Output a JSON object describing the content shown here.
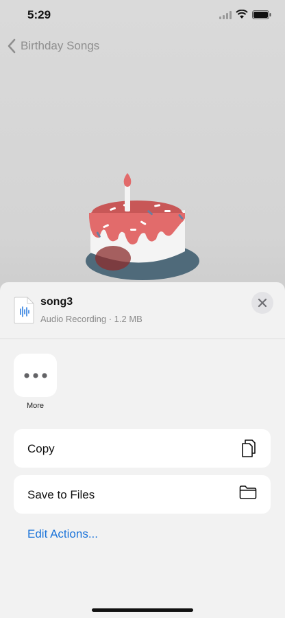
{
  "status_bar": {
    "time": "5:29"
  },
  "nav": {
    "back_label": "Birthday Songs"
  },
  "sheet": {
    "file_name": "song3",
    "file_meta": "Audio Recording · 1.2 MB",
    "more_label": "More",
    "actions": [
      {
        "label": "Copy",
        "icon": "copy-icon"
      },
      {
        "label": "Save to Files",
        "icon": "folder-icon"
      }
    ],
    "edit_actions": "Edit Actions..."
  },
  "colors": {
    "accent": "#1a73d9",
    "icing": "#e26b6b",
    "plate": "#4f6a7a"
  }
}
